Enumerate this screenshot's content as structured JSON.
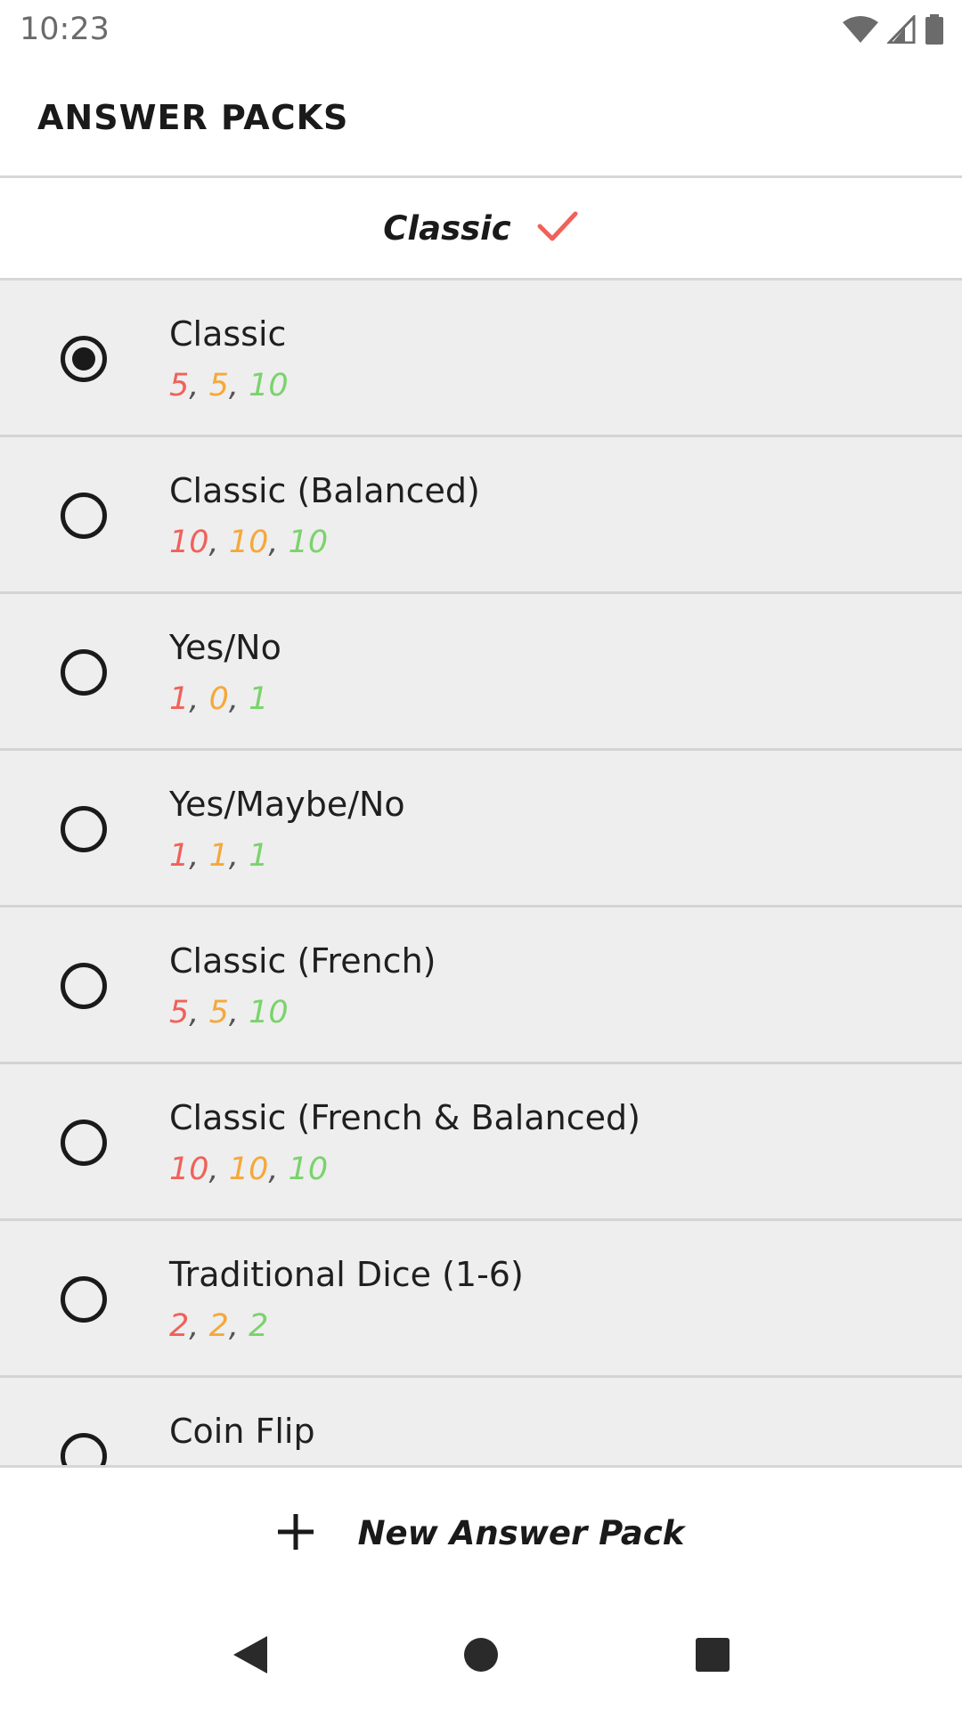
{
  "status_bar": {
    "time": "10:23",
    "icons": [
      "wifi-icon",
      "cell-signal-icon",
      "battery-icon"
    ]
  },
  "app_bar": {
    "title": "ANSWER PACKS"
  },
  "selected_pack": {
    "name": "Classic",
    "check_icon": "checkmark-icon",
    "check_color": "#f0615a"
  },
  "colors": {
    "red": "#f0615a",
    "orange": "#f5a83a",
    "green": "#7ad36c"
  },
  "packs": [
    {
      "name": "Classic",
      "selected": true,
      "red": "5",
      "orange": "5",
      "green": "10"
    },
    {
      "name": "Classic (Balanced)",
      "selected": false,
      "red": "10",
      "orange": "10",
      "green": "10"
    },
    {
      "name": "Yes/No",
      "selected": false,
      "red": "1",
      "orange": "0",
      "green": "1"
    },
    {
      "name": "Yes/Maybe/No",
      "selected": false,
      "red": "1",
      "orange": "1",
      "green": "1"
    },
    {
      "name": "Classic (French)",
      "selected": false,
      "red": "5",
      "orange": "5",
      "green": "10"
    },
    {
      "name": "Classic (French & Balanced)",
      "selected": false,
      "red": "10",
      "orange": "10",
      "green": "10"
    },
    {
      "name": "Traditional Dice (1-6)",
      "selected": false,
      "red": "2",
      "orange": "2",
      "green": "2"
    },
    {
      "name": "Coin Flip",
      "selected": false,
      "red": "",
      "orange": "",
      "green": ""
    }
  ],
  "separator": ",",
  "new_pack": {
    "label": "New Answer Pack",
    "icon": "plus-icon"
  },
  "nav_bar": {
    "icons": [
      "back-icon",
      "home-icon",
      "recents-icon"
    ]
  }
}
